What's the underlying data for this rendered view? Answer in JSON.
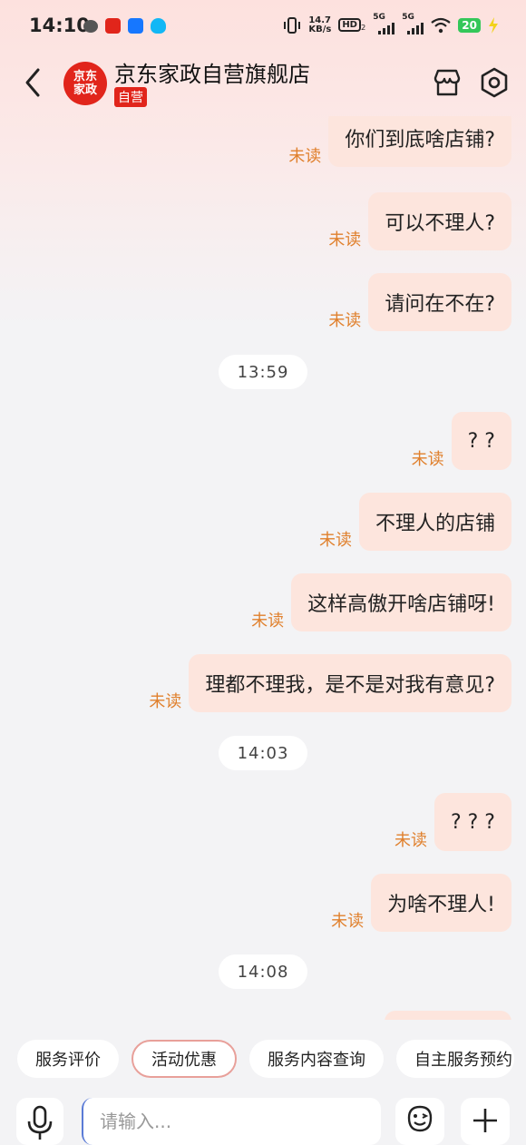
{
  "status_bar": {
    "time": "14:10",
    "speed_value": "14.7",
    "speed_unit": "KB/s",
    "hd_label": "HD",
    "hd_sub": "2",
    "signal1": "5G",
    "signal2": "5G",
    "battery": "20",
    "app_icons": [
      "wechat-icon",
      "redpacket-icon",
      "alipay-icon",
      "qq-icon"
    ]
  },
  "header": {
    "avatar_line1": "京东",
    "avatar_line2": "家政",
    "shop_name": "京东家政自营旗舰店",
    "badge": "自营"
  },
  "unread_label": "未读",
  "messages": [
    {
      "type": "sent",
      "text": "你们到底啥店铺?",
      "status": "未读"
    },
    {
      "type": "sent",
      "text": "可以不理人?",
      "status": "未读"
    },
    {
      "type": "sent",
      "text": "请问在不在?",
      "status": "未读"
    },
    {
      "type": "time",
      "text": "13:59"
    },
    {
      "type": "sent",
      "text": "? ?",
      "status": "未读"
    },
    {
      "type": "sent",
      "text": "不理人的店铺",
      "status": "未读"
    },
    {
      "type": "sent",
      "text": "这样高傲开啥店铺呀!",
      "status": "未读"
    },
    {
      "type": "sent",
      "text": "理都不理我，是不是对我有意见?",
      "status": "未读"
    },
    {
      "type": "time",
      "text": "14:03"
    },
    {
      "type": "sent",
      "text": "? ? ?",
      "status": "未读"
    },
    {
      "type": "sent",
      "text": "为啥不理人!",
      "status": "未读"
    },
    {
      "type": "time",
      "text": "14:08"
    }
  ],
  "quick_actions": [
    {
      "label": "服务评价",
      "active": false
    },
    {
      "label": "活动优惠",
      "active": true
    },
    {
      "label": "服务内容查询",
      "active": false
    },
    {
      "label": "自主服务预约",
      "active": false
    }
  ],
  "input": {
    "placeholder": "请输入..."
  },
  "colors": {
    "accent": "#e1251b",
    "bubble": "#fde5dd",
    "unread": "#e0802d"
  }
}
